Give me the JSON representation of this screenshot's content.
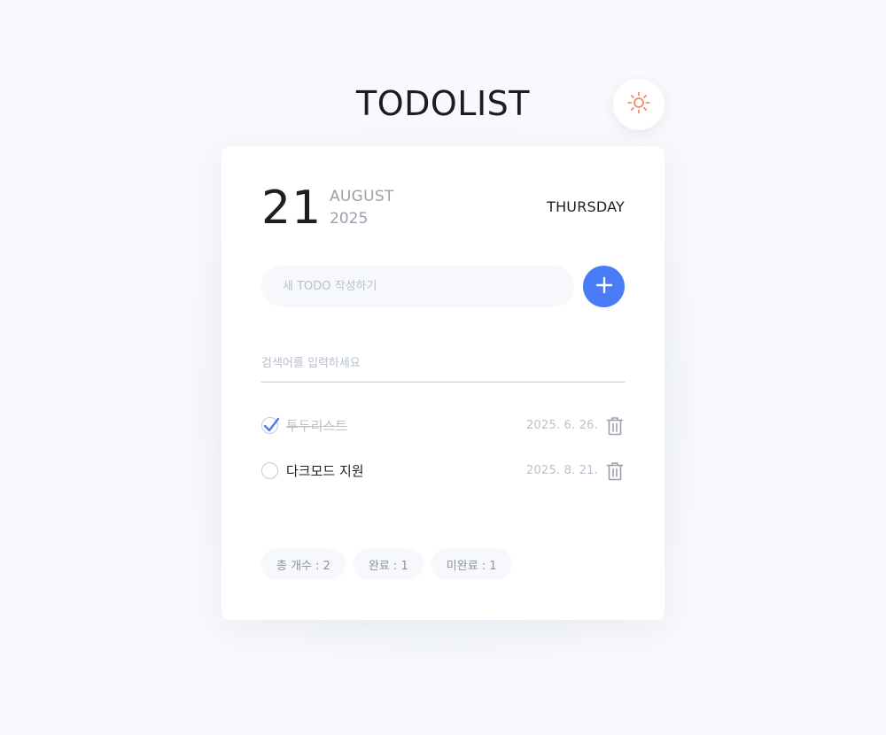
{
  "header": {
    "title": "TODOLIST",
    "theme_icon": "sun-icon"
  },
  "date": {
    "day": "21",
    "month": "AUGUST",
    "year": "2025",
    "weekday": "THURSDAY"
  },
  "new_todo": {
    "placeholder": "새 TODO 작성하기",
    "add_icon": "plus-icon"
  },
  "search": {
    "placeholder": "검색어를 입력하세요"
  },
  "todos": [
    {
      "text": "투두리스트",
      "date": "2025. 6. 26.",
      "done": true
    },
    {
      "text": "다크모드 지원",
      "date": "2025. 8. 21.",
      "done": false
    }
  ],
  "stats": {
    "total": "총 개수 : 2",
    "done": "완료 : 1",
    "undone": "미완료 : 1"
  },
  "colors": {
    "accent": "#4a7cf7",
    "sun": "#f08a6a",
    "muted": "#b8c1cd"
  }
}
